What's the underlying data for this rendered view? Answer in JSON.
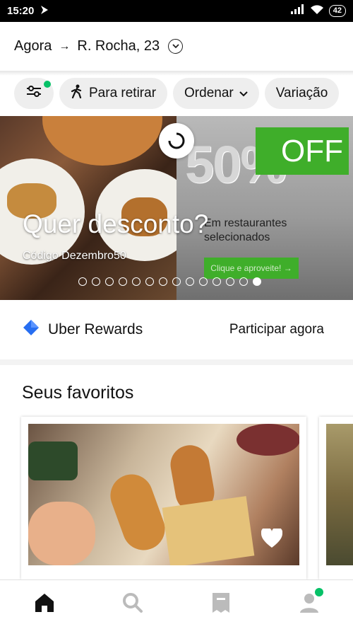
{
  "status_bar": {
    "time": "15:20",
    "battery": "42"
  },
  "address_bar": {
    "when": "Agora",
    "address": "R. Rocha, 23"
  },
  "filters": [
    {
      "label": "Para retirar"
    },
    {
      "label": "Ordenar"
    },
    {
      "label": "Variação"
    }
  ],
  "hero": {
    "headline": "Quer desconto?",
    "code": "Código Dezembro50",
    "promo_percent": "50%",
    "promo_off": "OFF",
    "promo_sub": "Em restaurantes selecionados",
    "promo_cta": "Clique e aproveite! →",
    "total_slides": 14,
    "active_slide": 14
  },
  "rewards": {
    "label": "Uber Rewards",
    "action": "Participar agora"
  },
  "favorites": {
    "title": "Seus favoritos"
  },
  "colors": {
    "accent_green": "#06c167",
    "rewards_blue": "#276ef1"
  },
  "bottom_nav": [
    {
      "icon": "home-icon",
      "active": true
    },
    {
      "icon": "search-icon",
      "active": false
    },
    {
      "icon": "orders-icon",
      "active": false
    },
    {
      "icon": "account-icon",
      "active": false
    }
  ]
}
